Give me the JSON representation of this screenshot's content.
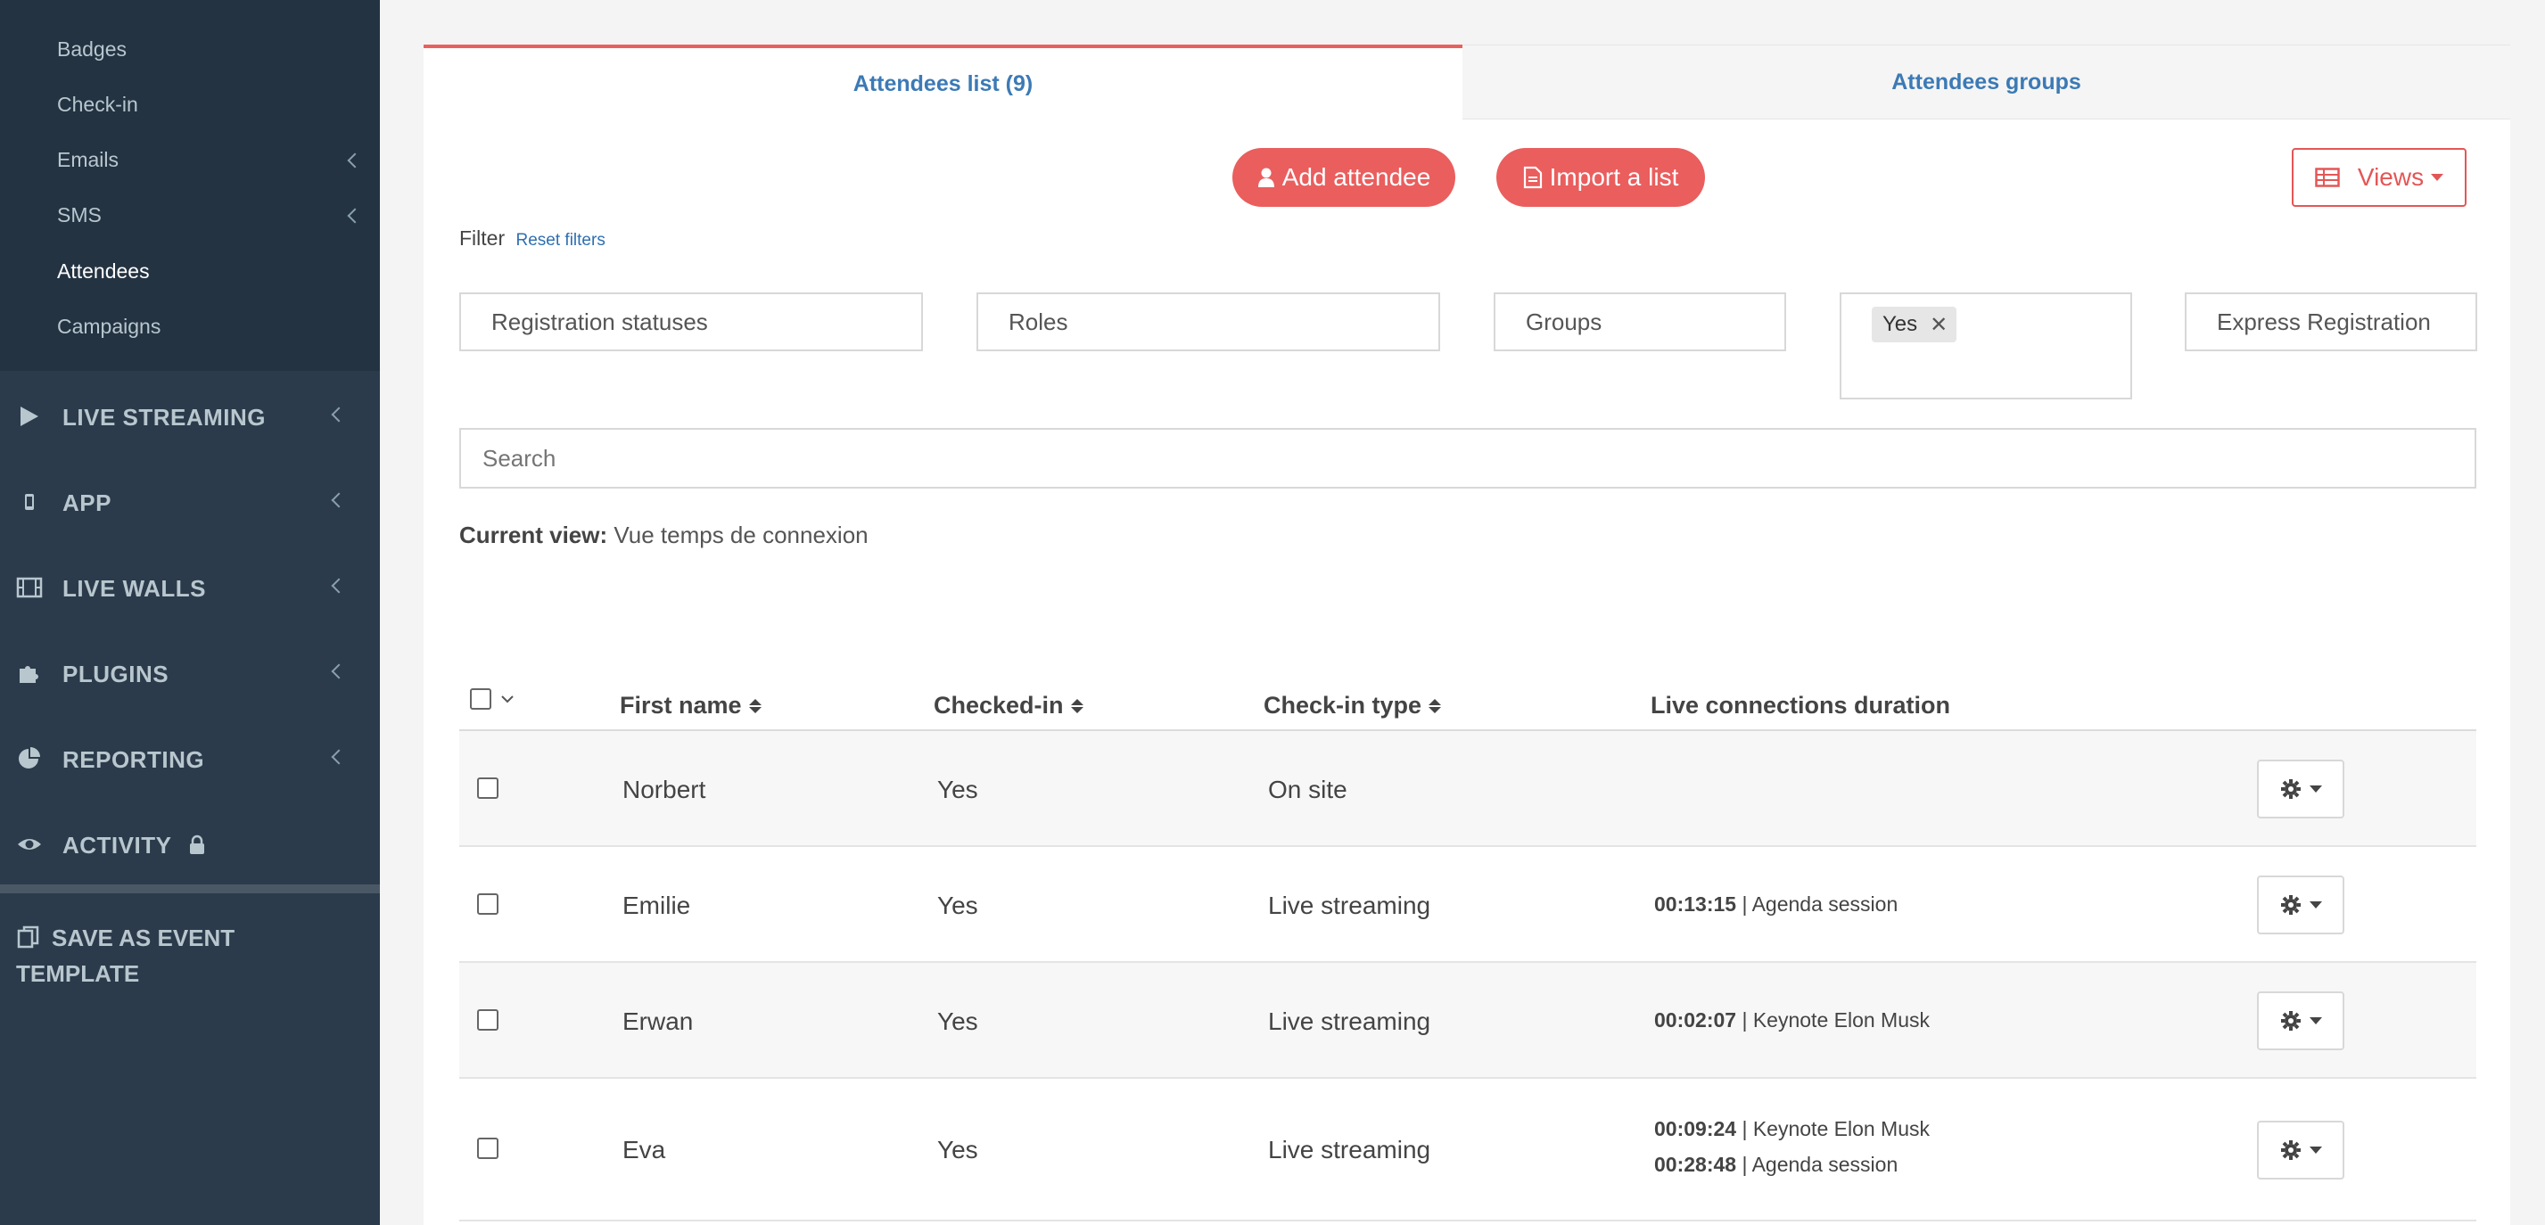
{
  "sidebar": {
    "submenu": [
      {
        "label": "Badges"
      },
      {
        "label": "Check-in"
      },
      {
        "label": "Emails"
      },
      {
        "label": "SMS"
      },
      {
        "label": "Attendees"
      },
      {
        "label": "Campaigns"
      }
    ],
    "menu": [
      {
        "label": "LIVE STREAMING",
        "icon": "play-icon"
      },
      {
        "label": "APP",
        "icon": "mobile-icon"
      },
      {
        "label": "LIVE WALLS",
        "icon": "film-icon"
      },
      {
        "label": "PLUGINS",
        "icon": "puzzle-icon"
      },
      {
        "label": "REPORTING",
        "icon": "pie-chart-icon"
      },
      {
        "label": "ACTIVITY",
        "icon": "eye-icon"
      }
    ],
    "save_template": "SAVE AS EVENT TEMPLATE"
  },
  "tabs": {
    "list": "Attendees list (9)",
    "groups": "Attendees groups"
  },
  "actions": {
    "add": "Add attendee",
    "import": "Import a list",
    "views": "Views"
  },
  "filter": {
    "label": "Filter",
    "reset": "Reset filters",
    "statuses": "Registration statuses",
    "roles": "Roles",
    "groups": "Groups",
    "tag": "Yes",
    "express": "Express Registration"
  },
  "search": {
    "placeholder": "Search"
  },
  "current_view": {
    "label": "Current view:",
    "value": "Vue temps de connexion"
  },
  "table": {
    "headers": {
      "first_name": "First name",
      "checked_in": "Checked-in",
      "checkin_type": "Check-in type",
      "live_duration": "Live connections duration"
    },
    "rows": [
      {
        "first_name": "Norbert",
        "checked_in": "Yes",
        "checkin_type": "On site",
        "connections": []
      },
      {
        "first_name": "Emilie",
        "checked_in": "Yes",
        "checkin_type": "Live streaming",
        "connections": [
          {
            "time": "00:13:15",
            "session": " | Agenda session"
          }
        ]
      },
      {
        "first_name": "Erwan",
        "checked_in": "Yes",
        "checkin_type": "Live streaming",
        "connections": [
          {
            "time": "00:02:07",
            "session": " | Keynote Elon Musk"
          }
        ]
      },
      {
        "first_name": "Eva",
        "checked_in": "Yes",
        "checkin_type": "Live streaming",
        "connections": [
          {
            "time": "00:09:24",
            "session": " | Keynote Elon Musk"
          },
          {
            "time": "00:28:48",
            "session": " | Agenda session"
          }
        ]
      }
    ]
  },
  "colors": {
    "sidebar_bg": "#2c3b4b",
    "accent_red": "#ea5e5e",
    "link_blue": "#3c7ab5"
  }
}
